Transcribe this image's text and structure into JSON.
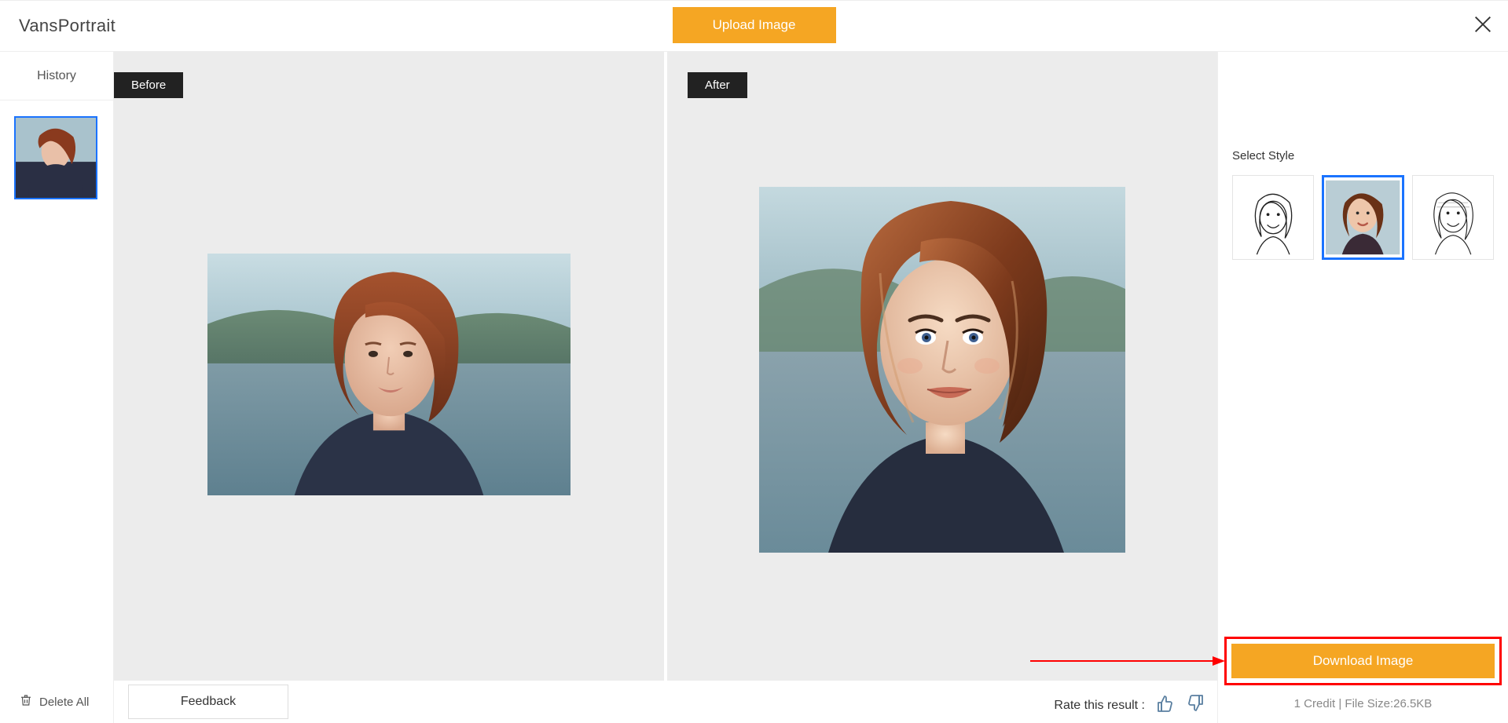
{
  "header": {
    "brand": "VansPortrait",
    "upload_label": "Upload Image"
  },
  "history": {
    "tab_label": "History",
    "delete_all_label": "Delete All"
  },
  "compare": {
    "before_label": "Before",
    "after_label": "After"
  },
  "bottom": {
    "feedback_label": "Feedback",
    "rate_label": "Rate this result :"
  },
  "right": {
    "select_style_label": "Select Style",
    "download_label": "Download Image",
    "credit_line": "1 Credit | File Size:26.5KB"
  }
}
